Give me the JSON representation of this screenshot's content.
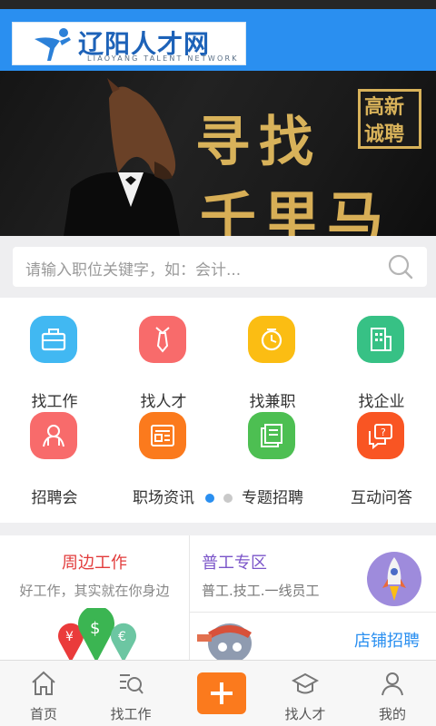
{
  "header": {
    "logo_title": "辽阳人才网",
    "logo_subtitle": "LIAOYANG TALENT NETWORK"
  },
  "banner": {
    "headline_line1": "寻找",
    "headline_line2": "千里马",
    "tag_line1": "高新",
    "tag_line2": "诚聘"
  },
  "search": {
    "placeholder": "请输入职位关键字，如：会计..."
  },
  "menu": {
    "items": [
      {
        "label": "找工作",
        "icon": "briefcase-icon",
        "color": "#41b8f2"
      },
      {
        "label": "找人才",
        "icon": "tie-icon",
        "color": "#f86b6b"
      },
      {
        "label": "找兼职",
        "icon": "clock-icon",
        "color": "#fbbd13"
      },
      {
        "label": "找企业",
        "icon": "building-icon",
        "color": "#37c185"
      },
      {
        "label": "招聘会",
        "icon": "people-icon",
        "color": "#f86b6b"
      },
      {
        "label": "职场资讯",
        "icon": "news-icon",
        "color": "#fb7a1d"
      },
      {
        "label": "专题招聘",
        "icon": "docs-icon",
        "color": "#4dbf52"
      },
      {
        "label": "互动问答",
        "icon": "chat-icon",
        "color": "#f95523"
      }
    ],
    "page_indicator": {
      "active": 1,
      "total": 2
    }
  },
  "promo": {
    "nearby_title": "周边工作",
    "nearby_subtitle": "好工作，其实就在你身边",
    "general_title": "普工专区",
    "general_subtitle": "普工.技工.一线员工",
    "shop_title": "店铺招聘"
  },
  "tabbar": {
    "home": "首页",
    "find_job": "找工作",
    "find_talent": "找人才",
    "mine": "我的"
  },
  "colors": {
    "brand": "#2a8ff0",
    "accent": "#fb7a1d"
  }
}
